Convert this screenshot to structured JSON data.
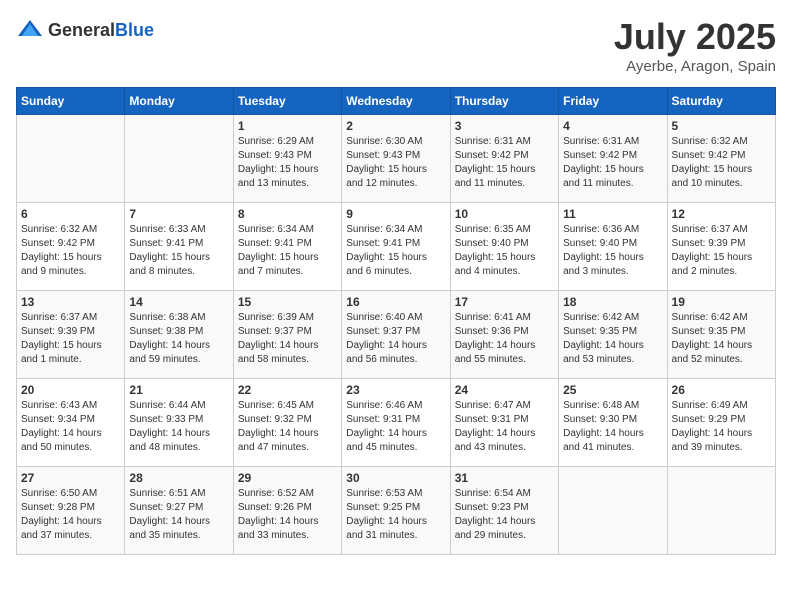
{
  "header": {
    "logo_general": "General",
    "logo_blue": "Blue",
    "month_year": "July 2025",
    "location": "Ayerbe, Aragon, Spain"
  },
  "weekdays": [
    "Sunday",
    "Monday",
    "Tuesday",
    "Wednesday",
    "Thursday",
    "Friday",
    "Saturday"
  ],
  "weeks": [
    [
      {
        "day": "",
        "sunrise": "",
        "sunset": "",
        "daylight": ""
      },
      {
        "day": "",
        "sunrise": "",
        "sunset": "",
        "daylight": ""
      },
      {
        "day": "1",
        "sunrise": "Sunrise: 6:29 AM",
        "sunset": "Sunset: 9:43 PM",
        "daylight": "Daylight: 15 hours and 13 minutes."
      },
      {
        "day": "2",
        "sunrise": "Sunrise: 6:30 AM",
        "sunset": "Sunset: 9:43 PM",
        "daylight": "Daylight: 15 hours and 12 minutes."
      },
      {
        "day": "3",
        "sunrise": "Sunrise: 6:31 AM",
        "sunset": "Sunset: 9:42 PM",
        "daylight": "Daylight: 15 hours and 11 minutes."
      },
      {
        "day": "4",
        "sunrise": "Sunrise: 6:31 AM",
        "sunset": "Sunset: 9:42 PM",
        "daylight": "Daylight: 15 hours and 11 minutes."
      },
      {
        "day": "5",
        "sunrise": "Sunrise: 6:32 AM",
        "sunset": "Sunset: 9:42 PM",
        "daylight": "Daylight: 15 hours and 10 minutes."
      }
    ],
    [
      {
        "day": "6",
        "sunrise": "Sunrise: 6:32 AM",
        "sunset": "Sunset: 9:42 PM",
        "daylight": "Daylight: 15 hours and 9 minutes."
      },
      {
        "day": "7",
        "sunrise": "Sunrise: 6:33 AM",
        "sunset": "Sunset: 9:41 PM",
        "daylight": "Daylight: 15 hours and 8 minutes."
      },
      {
        "day": "8",
        "sunrise": "Sunrise: 6:34 AM",
        "sunset": "Sunset: 9:41 PM",
        "daylight": "Daylight: 15 hours and 7 minutes."
      },
      {
        "day": "9",
        "sunrise": "Sunrise: 6:34 AM",
        "sunset": "Sunset: 9:41 PM",
        "daylight": "Daylight: 15 hours and 6 minutes."
      },
      {
        "day": "10",
        "sunrise": "Sunrise: 6:35 AM",
        "sunset": "Sunset: 9:40 PM",
        "daylight": "Daylight: 15 hours and 4 minutes."
      },
      {
        "day": "11",
        "sunrise": "Sunrise: 6:36 AM",
        "sunset": "Sunset: 9:40 PM",
        "daylight": "Daylight: 15 hours and 3 minutes."
      },
      {
        "day": "12",
        "sunrise": "Sunrise: 6:37 AM",
        "sunset": "Sunset: 9:39 PM",
        "daylight": "Daylight: 15 hours and 2 minutes."
      }
    ],
    [
      {
        "day": "13",
        "sunrise": "Sunrise: 6:37 AM",
        "sunset": "Sunset: 9:39 PM",
        "daylight": "Daylight: 15 hours and 1 minute."
      },
      {
        "day": "14",
        "sunrise": "Sunrise: 6:38 AM",
        "sunset": "Sunset: 9:38 PM",
        "daylight": "Daylight: 14 hours and 59 minutes."
      },
      {
        "day": "15",
        "sunrise": "Sunrise: 6:39 AM",
        "sunset": "Sunset: 9:37 PM",
        "daylight": "Daylight: 14 hours and 58 minutes."
      },
      {
        "day": "16",
        "sunrise": "Sunrise: 6:40 AM",
        "sunset": "Sunset: 9:37 PM",
        "daylight": "Daylight: 14 hours and 56 minutes."
      },
      {
        "day": "17",
        "sunrise": "Sunrise: 6:41 AM",
        "sunset": "Sunset: 9:36 PM",
        "daylight": "Daylight: 14 hours and 55 minutes."
      },
      {
        "day": "18",
        "sunrise": "Sunrise: 6:42 AM",
        "sunset": "Sunset: 9:35 PM",
        "daylight": "Daylight: 14 hours and 53 minutes."
      },
      {
        "day": "19",
        "sunrise": "Sunrise: 6:42 AM",
        "sunset": "Sunset: 9:35 PM",
        "daylight": "Daylight: 14 hours and 52 minutes."
      }
    ],
    [
      {
        "day": "20",
        "sunrise": "Sunrise: 6:43 AM",
        "sunset": "Sunset: 9:34 PM",
        "daylight": "Daylight: 14 hours and 50 minutes."
      },
      {
        "day": "21",
        "sunrise": "Sunrise: 6:44 AM",
        "sunset": "Sunset: 9:33 PM",
        "daylight": "Daylight: 14 hours and 48 minutes."
      },
      {
        "day": "22",
        "sunrise": "Sunrise: 6:45 AM",
        "sunset": "Sunset: 9:32 PM",
        "daylight": "Daylight: 14 hours and 47 minutes."
      },
      {
        "day": "23",
        "sunrise": "Sunrise: 6:46 AM",
        "sunset": "Sunset: 9:31 PM",
        "daylight": "Daylight: 14 hours and 45 minutes."
      },
      {
        "day": "24",
        "sunrise": "Sunrise: 6:47 AM",
        "sunset": "Sunset: 9:31 PM",
        "daylight": "Daylight: 14 hours and 43 minutes."
      },
      {
        "day": "25",
        "sunrise": "Sunrise: 6:48 AM",
        "sunset": "Sunset: 9:30 PM",
        "daylight": "Daylight: 14 hours and 41 minutes."
      },
      {
        "day": "26",
        "sunrise": "Sunrise: 6:49 AM",
        "sunset": "Sunset: 9:29 PM",
        "daylight": "Daylight: 14 hours and 39 minutes."
      }
    ],
    [
      {
        "day": "27",
        "sunrise": "Sunrise: 6:50 AM",
        "sunset": "Sunset: 9:28 PM",
        "daylight": "Daylight: 14 hours and 37 minutes."
      },
      {
        "day": "28",
        "sunrise": "Sunrise: 6:51 AM",
        "sunset": "Sunset: 9:27 PM",
        "daylight": "Daylight: 14 hours and 35 minutes."
      },
      {
        "day": "29",
        "sunrise": "Sunrise: 6:52 AM",
        "sunset": "Sunset: 9:26 PM",
        "daylight": "Daylight: 14 hours and 33 minutes."
      },
      {
        "day": "30",
        "sunrise": "Sunrise: 6:53 AM",
        "sunset": "Sunset: 9:25 PM",
        "daylight": "Daylight: 14 hours and 31 minutes."
      },
      {
        "day": "31",
        "sunrise": "Sunrise: 6:54 AM",
        "sunset": "Sunset: 9:23 PM",
        "daylight": "Daylight: 14 hours and 29 minutes."
      },
      {
        "day": "",
        "sunrise": "",
        "sunset": "",
        "daylight": ""
      },
      {
        "day": "",
        "sunrise": "",
        "sunset": "",
        "daylight": ""
      }
    ]
  ]
}
